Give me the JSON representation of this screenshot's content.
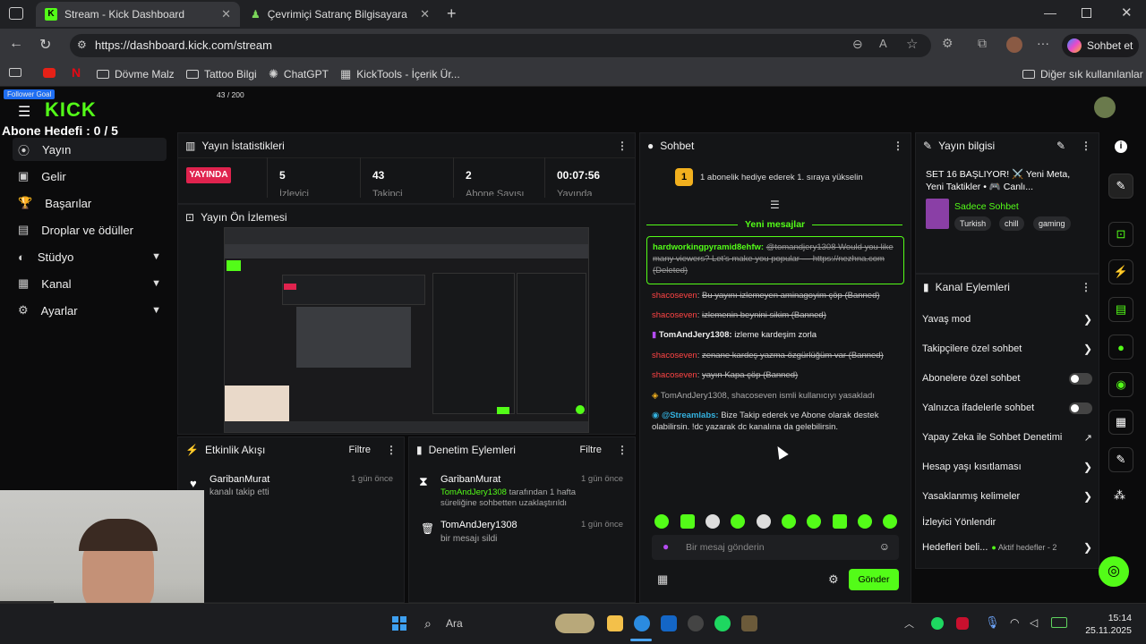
{
  "browser": {
    "tabs": [
      {
        "label": "Stream - Kick Dashboard"
      },
      {
        "label": "Çevrimiçi Satranç Bilgisayara Kar"
      }
    ],
    "url": "https://dashboard.kick.com/stream",
    "copilot": "Sohbet et",
    "bookmarks": [
      "Dövme Malz",
      "Tattoo Bilgi",
      "ChatGPT",
      "KickTools - İçerik Ür..."
    ],
    "other_bookmarks": "Diğer sık kullanılanlar"
  },
  "overlay": {
    "follower_goal": "Follower Goal",
    "follower_count": "43 / 200",
    "sub_goal": "Abone Hedefi : 0 / 5"
  },
  "logo": "KICK",
  "sidebar": [
    {
      "label": "Yayın"
    },
    {
      "label": "Gelir"
    },
    {
      "label": "Başarılar"
    },
    {
      "label": "Droplar ve ödüller"
    },
    {
      "label": "Stüdyo"
    },
    {
      "label": "Kanal"
    },
    {
      "label": "Ayarlar"
    }
  ],
  "stats": {
    "title": "Yayın İstatistikleri",
    "live": "YAYINDA",
    "viewers": "5",
    "viewers_label": "İzleyici",
    "followers": "43",
    "followers_label": "Takipçi",
    "subs": "2",
    "subs_label": "Abone Sayısı",
    "duration": "00:07:56",
    "duration_label": "Yayında"
  },
  "preview": {
    "title": "Yayın Ön İzlemesi"
  },
  "activity": {
    "title": "Etkinlik Akışı",
    "filter": "Filtre",
    "items": [
      {
        "user": "GaribanMurat",
        "text": "kanalı takip etti",
        "time": "1 gün önce"
      }
    ]
  },
  "moderation": {
    "title": "Denetim Eylemleri",
    "filter": "Filtre",
    "items": [
      {
        "user": "GaribanMurat",
        "text1": "TomAndJery1308",
        "text2": "tarafından 1 hafta süreliğine sohbetten uzaklaştırıldı",
        "time": "1 gün önce"
      },
      {
        "user": "TomAndJery1308",
        "text": "bir mesajı sildi",
        "time": "1 gün önce"
      }
    ]
  },
  "chat": {
    "title": "Sohbet",
    "gift_banner": "1 abonelik hediye ederek 1. sıraya yükselin",
    "new_messages": "Yeni mesajlar",
    "highlighted": {
      "user": "hardworkingpyramid8ehfw:",
      "text": "@tomandjery1308 Would you like many viewers? Let's make you popular — https://nezhna.com (Deleted)"
    },
    "lines": [
      {
        "user": "shacoseven",
        "text": "Bu yayını izlemeyen aminagoyim çöp (Banned)"
      },
      {
        "user": "shacoseven",
        "text": "izlemenin beynini sikim (Banned)"
      },
      {
        "user": "TomAndJery1308:",
        "text": "izleme kardeşim zorla"
      },
      {
        "user": "shacoseven",
        "text": "zenane kardeş yazma özgürlüğüm var (Banned)"
      },
      {
        "user": "shacoseven",
        "text": "yayın Kapa çöp (Banned)"
      },
      {
        "user": "",
        "text": "TomAndJery1308, shacoseven ismli kullanıcıyı yasakladı"
      },
      {
        "user": "@Streamlabs:",
        "text": "Bize Takip ederek ve Abone olarak destek olabilirsin. !dc yazarak dc kanalına da gelebilirsin."
      }
    ],
    "placeholder": "Bir mesaj gönderin",
    "send": "Gönder"
  },
  "stream_info": {
    "title": "Yayın bilgisi",
    "stream_title": "SET 16 BAŞLIYOR! ⚔️ Yeni Meta, Yeni Taktikler • 🎮 Canlı...",
    "category": "Sadece Sohbet",
    "tags": [
      "Turkish",
      "chill",
      "gaming"
    ]
  },
  "channel_actions": {
    "title": "Kanal Eylemleri",
    "items": [
      {
        "label": "Yavaş mod"
      },
      {
        "label": "Takipçilere özel sohbet"
      },
      {
        "label": "Abonelere özel sohbet"
      },
      {
        "label": "Yalnızca ifadelerle sohbet"
      },
      {
        "label": "Yapay Zeka ile Sohbet Denetimi"
      },
      {
        "label": "Hesap yaşı kısıtlaması"
      },
      {
        "label": "Yasaklanmış kelimeler"
      },
      {
        "label": "İzleyici Yönlendir"
      },
      {
        "label": "Hedefleri beli..."
      }
    ],
    "goals_active": "Aktif hedefler - 2"
  },
  "taskbar": {
    "search": "Ara",
    "time": "15:14",
    "date": "25.11.2025"
  },
  "colors": {
    "accent": "#53fc18",
    "live": "#e0234e",
    "panel": "#141517"
  }
}
